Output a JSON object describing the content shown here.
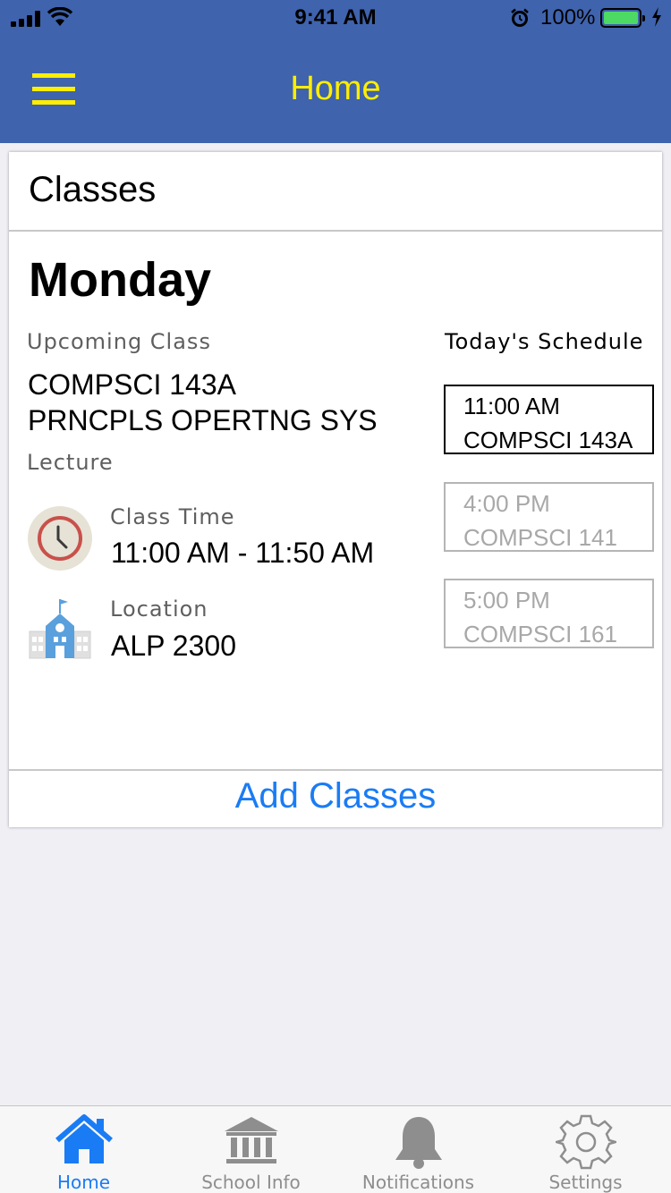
{
  "status_bar": {
    "time": "9:41 AM",
    "battery_percent": "100%",
    "battery_level": 1.0
  },
  "nav": {
    "title": "Home",
    "menu_icon": "hamburger-menu-icon",
    "accent_color": "#ffee00",
    "bar_color": "#3f63ad"
  },
  "card": {
    "header": "Classes",
    "day": "Monday",
    "upcoming_label": "Upcoming Class",
    "class_code": "COMPSCI 143A",
    "class_title": "PRNCPLS OPERTNG SYS",
    "class_type": "Lecture",
    "time_label": "Class Time",
    "time_value": "11:00 AM - 11:50 AM",
    "location_label": "Location",
    "location_value": "ALP 2300",
    "schedule_title": "Today's Schedule",
    "schedule": [
      {
        "time": "11:00  AM",
        "course": "COMPSCI 143A",
        "active": true
      },
      {
        "time": "4:00  PM",
        "course": "COMPSCI 141",
        "active": false
      },
      {
        "time": "5:00  PM",
        "course": "COMPSCI 161",
        "active": false
      }
    ],
    "add_button": "Add Classes"
  },
  "tabs": [
    {
      "label": "Home",
      "icon": "home-icon",
      "active": true
    },
    {
      "label": "School Info",
      "icon": "bank-building-icon",
      "active": false
    },
    {
      "label": "Notifications",
      "icon": "bell-icon",
      "active": false
    },
    {
      "label": "Settings",
      "icon": "gear-icon",
      "active": false
    }
  ]
}
